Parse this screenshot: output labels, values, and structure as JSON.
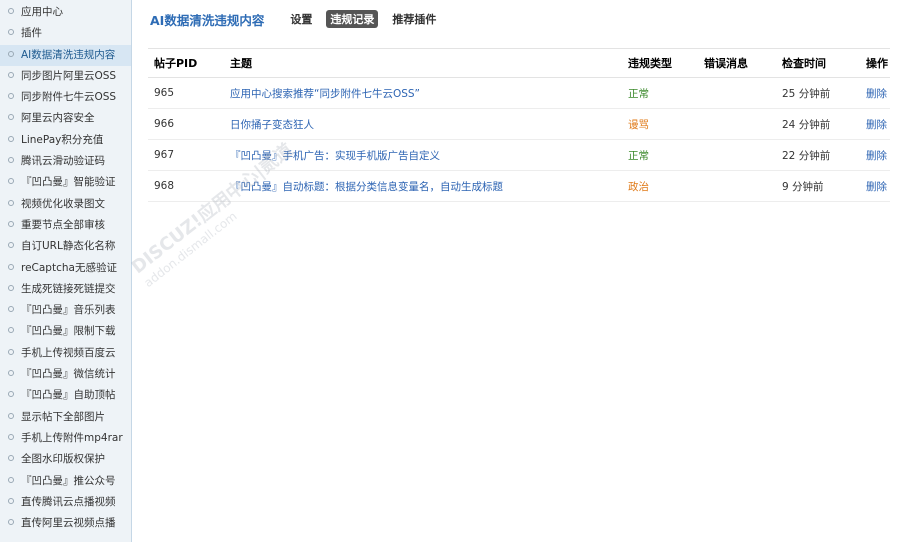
{
  "sidebar": {
    "items": [
      {
        "label": "应用中心"
      },
      {
        "label": "插件"
      },
      {
        "label": "AI数据清洗违规内容",
        "active": true
      },
      {
        "label": "同步图片阿里云OSS"
      },
      {
        "label": "同步附件七牛云OSS"
      },
      {
        "label": "阿里云内容安全"
      },
      {
        "label": "LinePay积分充值"
      },
      {
        "label": "腾讯云滑动验证码"
      },
      {
        "label": "『凹凸曼』智能验证"
      },
      {
        "label": "视频优化收录图文"
      },
      {
        "label": "重要节点全部审核"
      },
      {
        "label": "自订URL静态化名称"
      },
      {
        "label": "reCaptcha无感验证"
      },
      {
        "label": "生成死链接死链提交"
      },
      {
        "label": "『凹凸曼』音乐列表"
      },
      {
        "label": "『凹凸曼』限制下载"
      },
      {
        "label": "手机上传视频百度云"
      },
      {
        "label": "『凹凸曼』微信统计"
      },
      {
        "label": "『凹凸曼』自助顶帖"
      },
      {
        "label": "显示帖下全部图片"
      },
      {
        "label": "手机上传附件mp4rar"
      },
      {
        "label": "全图水印版权保护"
      },
      {
        "label": "『凹凸曼』推公众号"
      },
      {
        "label": "直传腾讯云点播视频"
      },
      {
        "label": "直传阿里云视频点播"
      }
    ]
  },
  "header": {
    "title": "AI数据清洗违规内容",
    "tabs": [
      {
        "label": "设置",
        "active": false
      },
      {
        "label": "违规记录",
        "active": true
      },
      {
        "label": "推荐插件",
        "active": false
      }
    ]
  },
  "table": {
    "columns": [
      "帖子PID",
      "主题",
      "违规类型",
      "错误消息",
      "检查时间",
      "操作"
    ],
    "rows": [
      {
        "pid": "965",
        "title": "应用中心搜索推荐“同步附件七牛云OSS”",
        "type": "正常",
        "type_class": "v-normal",
        "error": "",
        "time": "25 分钟前",
        "op": "删除"
      },
      {
        "pid": "966",
        "title": "日你捅子变态狂人",
        "type": "谩骂",
        "type_class": "v-abuse",
        "error": "",
        "time": "24 分钟前",
        "op": "删除"
      },
      {
        "pid": "967",
        "title": "『凹凸曼』手机广告：实现手机版广告自定义",
        "type": "正常",
        "type_class": "v-normal",
        "error": "",
        "time": "22 分钟前",
        "op": "删除"
      },
      {
        "pid": "968",
        "title": "『凹凸曼』自动标题：根据分类信息变量名，自动生成标题",
        "type": "政治",
        "type_class": "v-politics",
        "error": "",
        "time": "9 分钟前",
        "op": "删除"
      }
    ]
  },
  "watermark": {
    "brand": "DISCUZ!应用中心|贰道",
    "domain": "addon.dismall.com"
  },
  "colors": {
    "accent": "#2e6cb5",
    "normal": "#3c8a2c",
    "warning": "#e07b1a",
    "sidebar_bg": "#eef3f7"
  }
}
